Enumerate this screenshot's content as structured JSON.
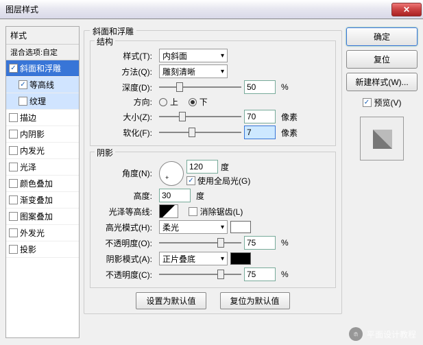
{
  "title": "图层样式",
  "left": {
    "header": "样式",
    "blend": "混合选项:自定",
    "items": [
      {
        "label": "斜面和浮雕",
        "checked": true,
        "selected": true
      },
      {
        "label": "等高线",
        "checked": true,
        "sub": true
      },
      {
        "label": "纹理",
        "checked": false,
        "sub": true
      },
      {
        "label": "描边",
        "checked": false
      },
      {
        "label": "内阴影",
        "checked": false
      },
      {
        "label": "内发光",
        "checked": false
      },
      {
        "label": "光泽",
        "checked": false
      },
      {
        "label": "颜色叠加",
        "checked": false
      },
      {
        "label": "渐变叠加",
        "checked": false
      },
      {
        "label": "图案叠加",
        "checked": false
      },
      {
        "label": "外发光",
        "checked": false
      },
      {
        "label": "投影",
        "checked": false
      }
    ]
  },
  "main": {
    "group_title": "斜面和浮雕",
    "struct": {
      "title": "结构",
      "style_lbl": "样式(T):",
      "style_val": "内斜面",
      "method_lbl": "方法(Q):",
      "method_val": "雕刻清晰",
      "depth_lbl": "深度(D):",
      "depth_val": "50",
      "depth_unit": "%",
      "dir_lbl": "方向:",
      "up": "上",
      "down": "下",
      "size_lbl": "大小(Z):",
      "size_val": "70",
      "size_unit": "像素",
      "soft_lbl": "软化(F):",
      "soft_val": "7",
      "soft_unit": "像素"
    },
    "shadow": {
      "title": "阴影",
      "angle_lbl": "角度(N):",
      "angle_val": "120",
      "angle_unit": "度",
      "global": "使用全局光(G)",
      "alt_lbl": "高度:",
      "alt_val": "30",
      "alt_unit": "度",
      "gloss_lbl": "光泽等高线:",
      "antialias": "消除锯齿(L)",
      "hi_lbl": "高光模式(H):",
      "hi_val": "柔光",
      "hi_color": "#ffffff",
      "hi_op_lbl": "不透明度(O):",
      "hi_op_val": "75",
      "hi_op_unit": "%",
      "sh_lbl": "阴影模式(A):",
      "sh_val": "正片叠底",
      "sh_color": "#000000",
      "sh_op_lbl": "不透明度(C):",
      "sh_op_val": "75",
      "sh_op_unit": "%"
    },
    "btn_default": "设置为默认值",
    "btn_reset": "复位为默认值"
  },
  "right": {
    "ok": "确定",
    "cancel": "复位",
    "new_style": "新建样式(W)...",
    "preview": "预览(V)"
  },
  "watermark": "平面设计教程"
}
